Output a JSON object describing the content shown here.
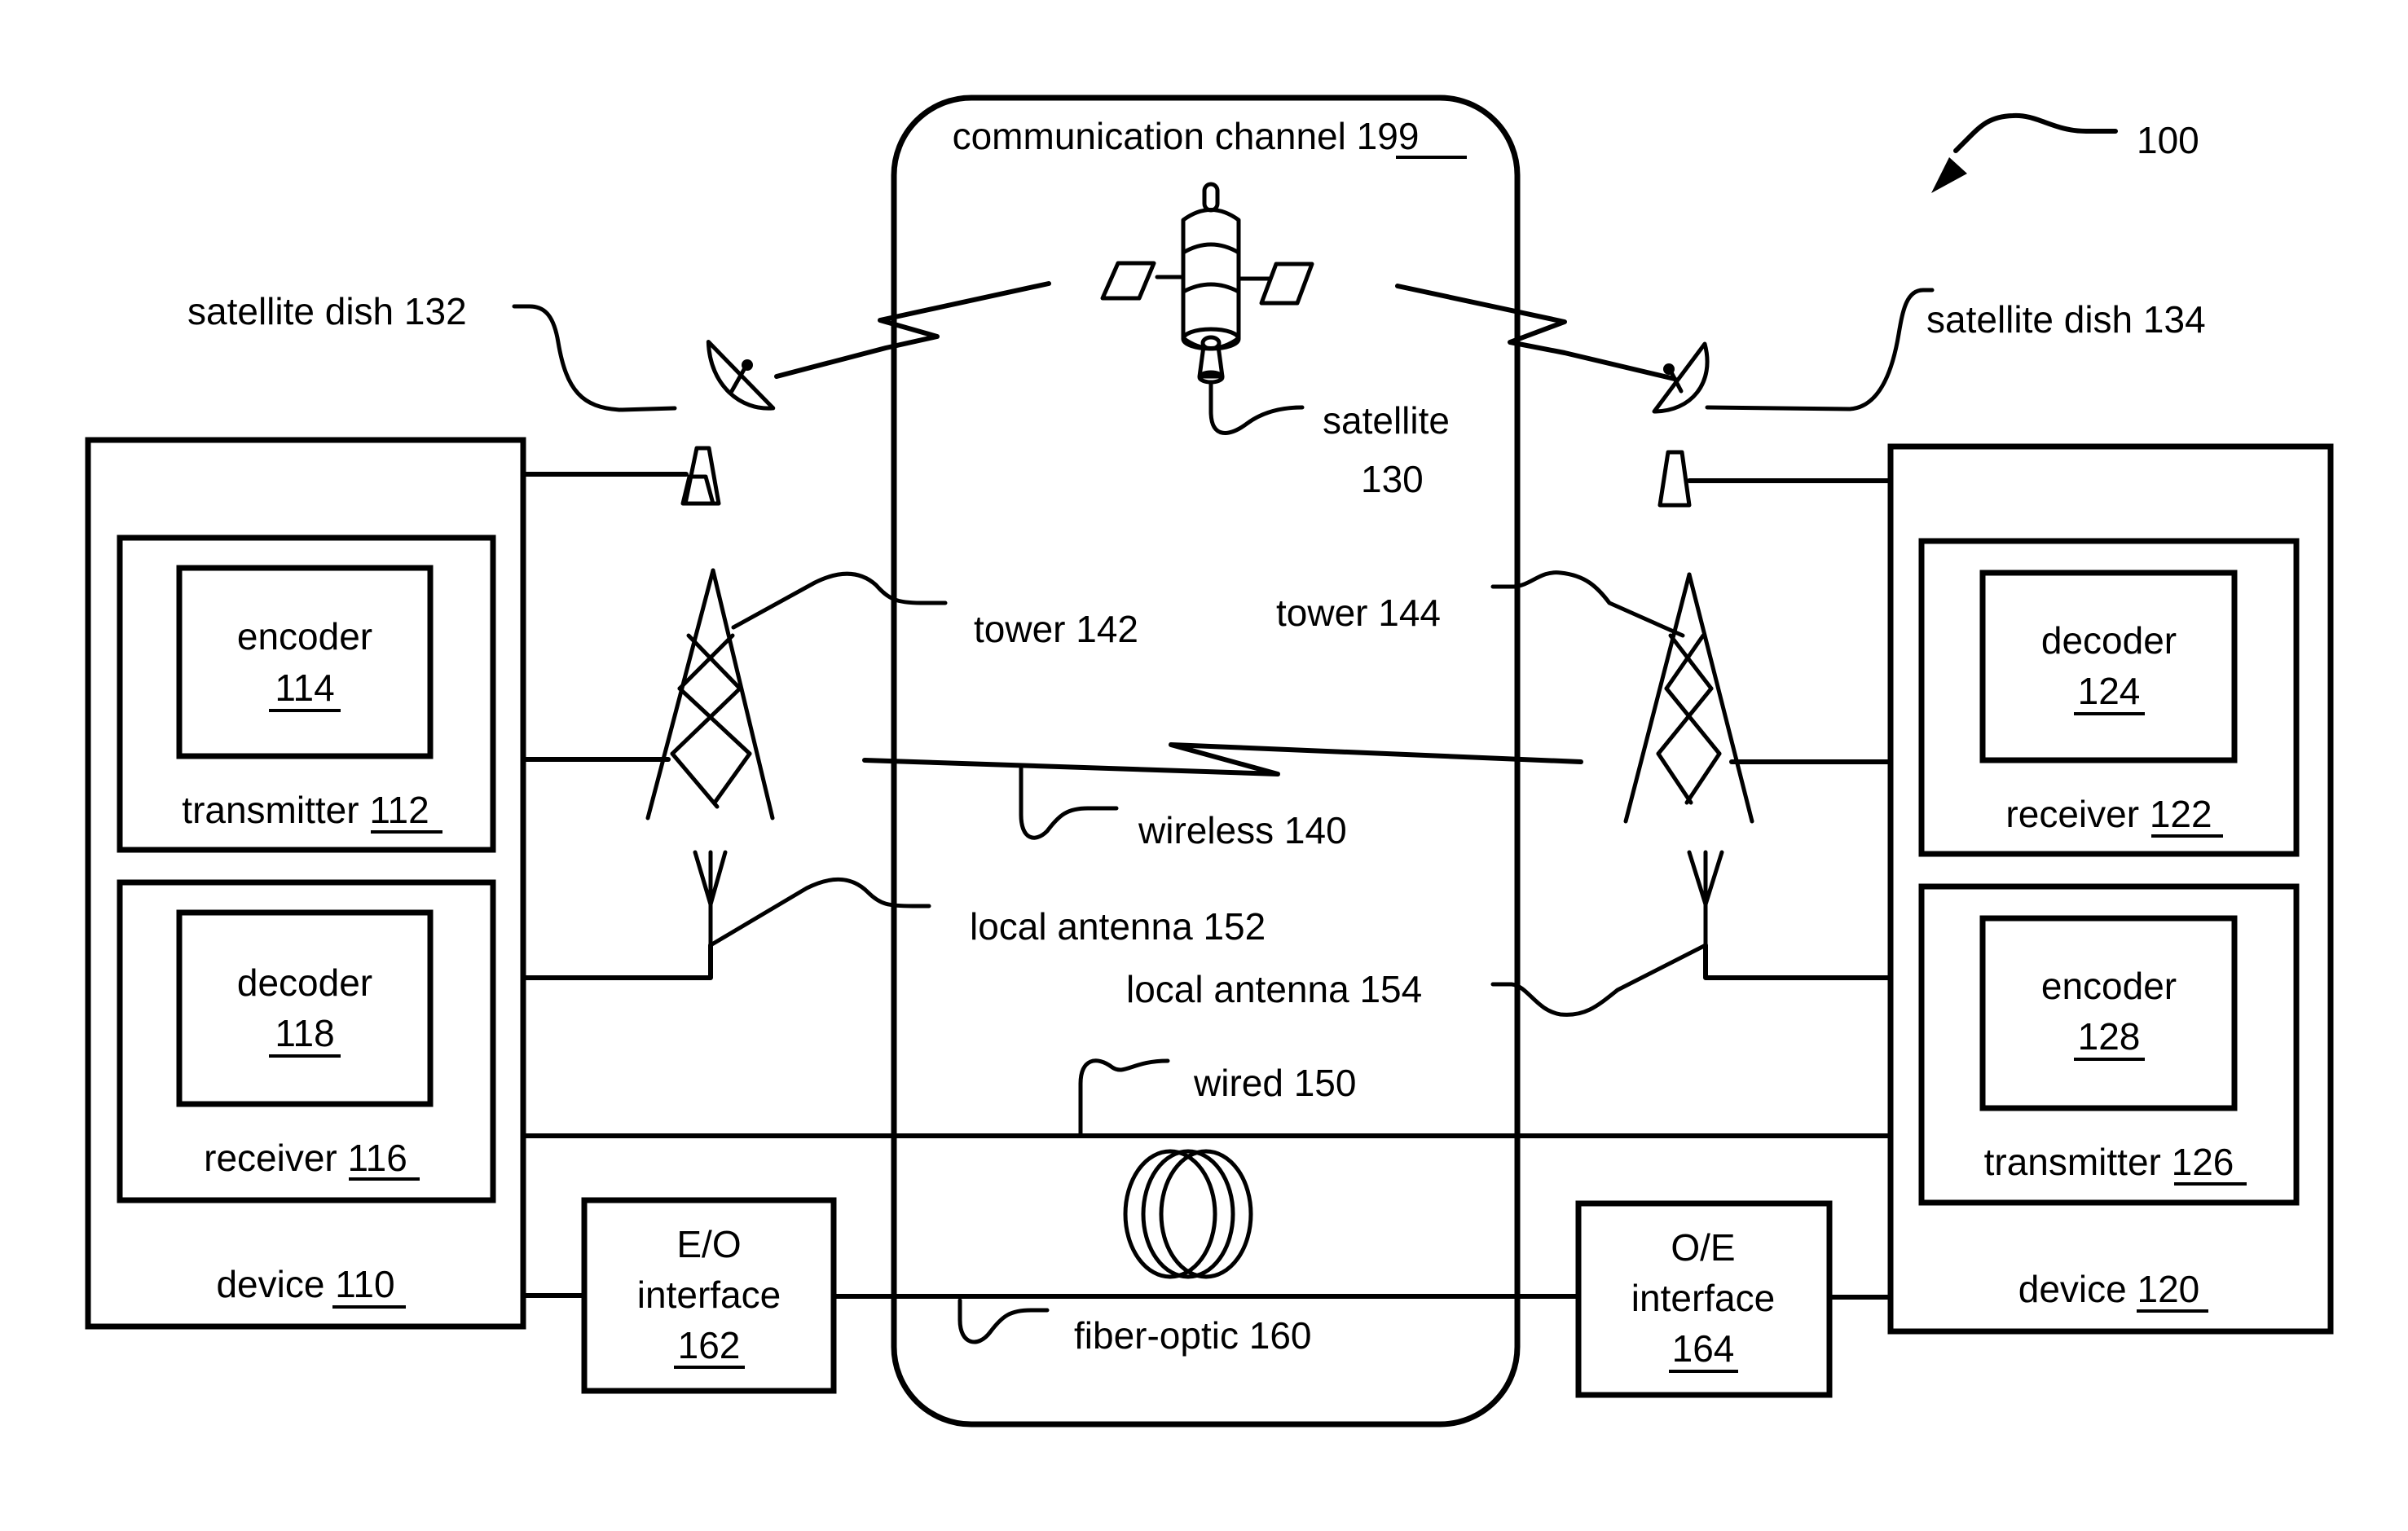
{
  "figure": {
    "reference": "100",
    "channel": {
      "label": "communication channel",
      "ref": "199"
    },
    "device_left": {
      "label": "device",
      "ref": "110",
      "transmitter": {
        "label": "transmitter",
        "ref": "112",
        "encoder": {
          "label": "encoder",
          "ref": "114"
        }
      },
      "receiver": {
        "label": "receiver",
        "ref": "116",
        "decoder": {
          "label": "decoder",
          "ref": "118"
        }
      }
    },
    "device_right": {
      "label": "device",
      "ref": "120",
      "receiver": {
        "label": "receiver",
        "ref": "122",
        "decoder": {
          "label": "decoder",
          "ref": "124"
        }
      },
      "transmitter": {
        "label": "transmitter",
        "ref": "126",
        "encoder": {
          "label": "encoder",
          "ref": "128"
        }
      }
    },
    "satellite": {
      "label": "satellite",
      "ref": "130"
    },
    "satellite_dish_left": "satellite dish 132",
    "satellite_dish_right": "satellite dish 134",
    "wireless": "wireless 140",
    "tower_left": "tower 142",
    "tower_right": "tower 144",
    "wired": "wired 150",
    "local_antenna_left": "local antenna 152",
    "local_antenna_right": "local antenna 154",
    "fiber_optic": "fiber-optic 160",
    "eo_interface": {
      "line1": "E/O",
      "line2": "interface",
      "ref": "162"
    },
    "oe_interface": {
      "line1": "O/E",
      "line2": "interface",
      "ref": "164"
    }
  }
}
